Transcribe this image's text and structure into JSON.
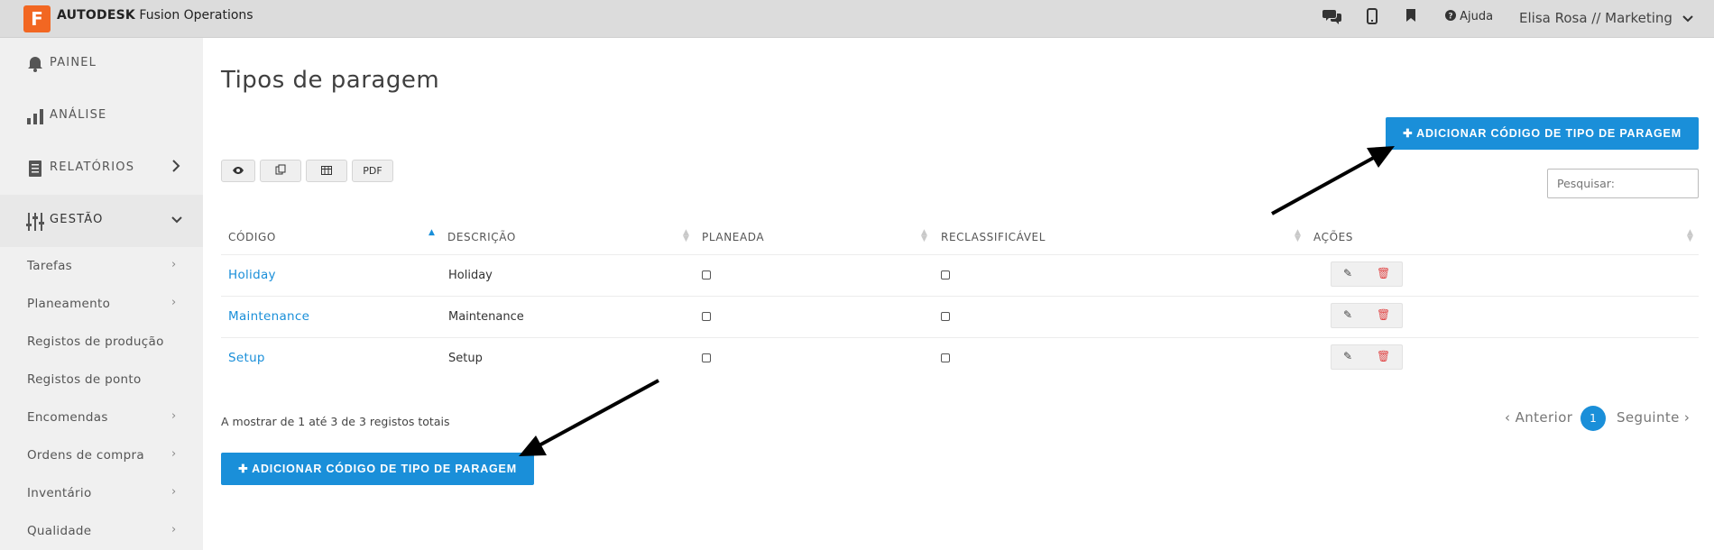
{
  "app": {
    "logo_letter": "F",
    "brand_bold": "AUTODESK",
    "brand_rest": " Fusion Operations"
  },
  "topbar": {
    "chat_icon": "chat-icon",
    "mobile_icon": "mobile-icon",
    "bookmark_icon": "bookmark-icon",
    "help_label": "Ajuda",
    "user": "Elisa Rosa // Marketing"
  },
  "sidebar": {
    "main": [
      {
        "label": "PAINEL",
        "icon": "bell-icon"
      },
      {
        "label": "ANÁLISE",
        "icon": "bar-chart-icon"
      },
      {
        "label": "RELATÓRIOS",
        "icon": "document-icon"
      },
      {
        "label": "GESTÃO",
        "icon": "sliders-icon"
      }
    ],
    "sub": [
      {
        "label": "Tarefas",
        "has_chevron": true
      },
      {
        "label": "Planeamento",
        "has_chevron": true
      },
      {
        "label": "Registos de produção",
        "has_chevron": false
      },
      {
        "label": "Registos de ponto",
        "has_chevron": false
      },
      {
        "label": "Encomendas",
        "has_chevron": true
      },
      {
        "label": "Ordens de compra",
        "has_chevron": true
      },
      {
        "label": "Inventário",
        "has_chevron": true
      },
      {
        "label": "Qualidade",
        "has_chevron": true
      }
    ]
  },
  "page": {
    "title": "Tipos de paragem",
    "add_button": "ADICIONAR CÓDIGO DE TIPO DE PARAGEM"
  },
  "toolbar": {
    "pdf_label": "PDF"
  },
  "search": {
    "placeholder": "Pesquisar:"
  },
  "table": {
    "headers": [
      "CÓDIGO",
      "DESCRIÇÃO",
      "PLANEADA",
      "RECLASSIFICÁVEL",
      "AÇÕES"
    ],
    "rows": [
      {
        "code": "Holiday",
        "description": "Holiday",
        "planned": false,
        "reclassifiable": false
      },
      {
        "code": "Maintenance",
        "description": "Maintenance",
        "planned": false,
        "reclassifiable": false
      },
      {
        "code": "Setup",
        "description": "Setup",
        "planned": false,
        "reclassifiable": false
      }
    ]
  },
  "footer": {
    "info": "A mostrar de 1 até 3 de 3 registos totais",
    "prev": "Anterior",
    "page": "1",
    "next": "Seguinte"
  },
  "colors": {
    "accent": "#1a8fd9",
    "logo": "#f26722",
    "delete": "#e04848"
  }
}
